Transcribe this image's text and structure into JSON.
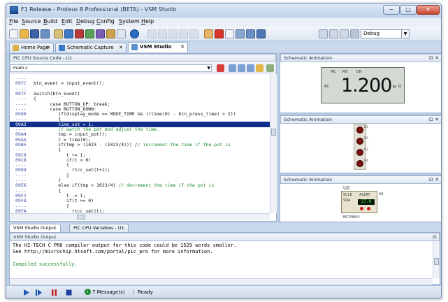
{
  "window": {
    "title": "F1 Release - Proteus 8 Professional (BETA) - VSM Studio",
    "min": "−",
    "max": "□",
    "close": "✕"
  },
  "menu": {
    "items": [
      "File",
      "Source",
      "Build",
      "Edit",
      "Debug",
      "Config",
      "System",
      "Help"
    ]
  },
  "toolbar": {
    "config_value": "Debug"
  },
  "doc_tabs": [
    {
      "label": "Home Page",
      "close": "✕"
    },
    {
      "label": "Schematic Capture",
      "close": "✕"
    },
    {
      "label": "VSM Studio",
      "close": "✕"
    }
  ],
  "source": {
    "panel_title": "PIC CPU Source Code - U1",
    "file": "main.c",
    "current_line": 9,
    "lines": [
      {
        "addr": "----",
        "code": ""
      },
      {
        "addr": "097C",
        "code": "btn_event = input_event();"
      },
      {
        "addr": "----",
        "code": ""
      },
      {
        "addr": "097F",
        "code": "switch(btn_event)"
      },
      {
        "addr": "----",
        "code": "{"
      },
      {
        "addr": "----",
        "code": "      case BUTTON_UP: break;"
      },
      {
        "addr": "----",
        "code": "      case BUTTON_DOWN:"
      },
      {
        "addr": "0980",
        "code": "         if(display_mode == MODE_TIME && ((time(0) - btn_press_time) > 2))"
      },
      {
        "addr": "----",
        "code": "         {"
      },
      {
        "addr": "09A2",
        "code": "         time_set = 1;"
      },
      {
        "addr": "----",
        "code": "         // watch the pot and adjust the time.",
        "comment": true
      },
      {
        "addr": "09A4",
        "code": "         tmp = input_pot();"
      },
      {
        "addr": "09AA",
        "code": "         t = time(0);"
      },
      {
        "addr": "09B5",
        "code": "         if(tmp > (1023 - (1023/4))) // increment the time if the pot is",
        "comment_from": 38
      },
      {
        "addr": "----",
        "code": "         {"
      },
      {
        "addr": "09C0",
        "code": "            t += 1;"
      },
      {
        "addr": "09C8",
        "code": "            if(t > 0)"
      },
      {
        "addr": "----",
        "code": "            {"
      },
      {
        "addr": "09D9",
        "code": "              rtcc_set(t+1);"
      },
      {
        "addr": "----",
        "code": "            }"
      },
      {
        "addr": "----",
        "code": "         }"
      },
      {
        "addr": "09E6",
        "code": "         else if(tmp < 1023/4) // decrement the time if the pot is",
        "comment_from": 31
      },
      {
        "addr": "----",
        "code": "         {"
      },
      {
        "addr": "09F2",
        "code": "            t -= 1;"
      },
      {
        "addr": "09F8",
        "code": "            if(t >= 0)"
      },
      {
        "addr": "----",
        "code": "            {"
      },
      {
        "addr": "09FA",
        "code": "              rtcc_set(t);"
      }
    ]
  },
  "animation": {
    "panel_title": "Schematic Animation",
    "panel_controls": "⊡ ✕",
    "lcd": {
      "value": "1.200",
      "labels": [
        "RC",
        "RH",
        "DH",
        "AC",
        "M",
        "Ω"
      ]
    },
    "leds": [
      "D1",
      "D2",
      "D3",
      "D4"
    ],
    "chip": {
      "name": "U2",
      "pin1": "SCLK",
      "pin2": "SDA",
      "pin3": "ALERT",
      "pin4": "A0",
      "display": "27.0",
      "part": "MCP9800"
    }
  },
  "output": {
    "tabs": [
      "VSM Studio Output",
      "PIC CPU Variables - U1"
    ],
    "panel_title": "VSM Studio Output",
    "lines": [
      "The HI-TECH C PRO compiler output for this code could be 1529 words smaller.",
      "See http://microchip.htsoft.com/portal/pic_pro for more information."
    ],
    "result": "Compiled successfully."
  },
  "status": {
    "messages": "7 Message(s)",
    "msg_badge": "i",
    "state": "Ready"
  },
  "colors": {
    "highlight": "#0f2f8a",
    "comment": "#1a8a2a",
    "address": "#3f52a6"
  }
}
